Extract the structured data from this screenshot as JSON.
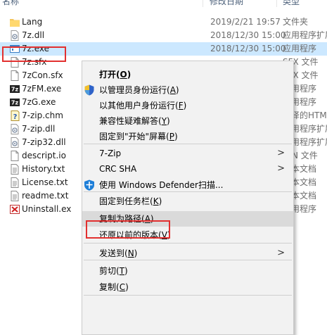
{
  "header": {
    "name": "名称",
    "date": "修改日期",
    "type": "类型"
  },
  "files": [
    {
      "name": "Lang",
      "date": "2019/2/21 19:57",
      "type": "文件夹",
      "icon": "folder-icon"
    },
    {
      "name": "7z.dll",
      "date": "2018/12/30 15:00",
      "type": "应用程序扩展",
      "icon": "dll-icon"
    },
    {
      "name": "7z.exe",
      "date": "2018/12/30 15:00",
      "type": "应用程序",
      "icon": "exe-icon"
    },
    {
      "name": "7z.sfx",
      "date": "",
      "type": "SFX 文件",
      "icon": "blank-file-icon"
    },
    {
      "name": "7zCon.sfx",
      "date": "",
      "type": "SFX 文件",
      "icon": "blank-file-icon"
    },
    {
      "name": "7zFM.exe",
      "date": "",
      "type": "应用程序",
      "icon": "7zip-icon"
    },
    {
      "name": "7zG.exe",
      "date": "",
      "type": "应用程序",
      "icon": "7zip-icon"
    },
    {
      "name": "7-zip.chm",
      "date": "",
      "type": "编译的HTML帮助文件",
      "icon": "help-file-icon"
    },
    {
      "name": "7-zip.dll",
      "date": "",
      "type": "应用程序扩展",
      "icon": "dll-icon"
    },
    {
      "name": "7-zip32.dll",
      "date": "",
      "type": "应用程序扩展",
      "icon": "dll-icon"
    },
    {
      "name": "descript.io",
      "date": "",
      "type": "ION 文件",
      "icon": "blank-file-icon"
    },
    {
      "name": "History.txt",
      "date": "",
      "type": "文本文档",
      "icon": "text-file-icon"
    },
    {
      "name": "License.txt",
      "date": "",
      "type": "文本文档",
      "icon": "text-file-icon"
    },
    {
      "name": "readme.txt",
      "date": "",
      "type": "文本文档",
      "icon": "text-file-icon"
    },
    {
      "name": "Uninstall.ex",
      "date": "",
      "type": "应用程序",
      "icon": "uninstall-icon"
    }
  ],
  "menu": {
    "items": [
      {
        "pre": "打开(",
        "key": "O",
        "post": ")",
        "bold": true
      },
      {
        "pre": "以管理员身份运行(",
        "key": "A",
        "post": ")",
        "icon": "uac-shield-icon"
      },
      {
        "pre": "以其他用户身份运行(",
        "key": "F",
        "post": ")"
      },
      {
        "pre": "兼容性疑难解答(",
        "key": "Y",
        "post": ")"
      },
      {
        "pre": "固定到\"开始\"屏幕(",
        "key": "P",
        "post": ")"
      },
      {
        "pre": "7-Zip",
        "key": "",
        "post": "",
        "arrow": ">"
      },
      {
        "pre": "CRC SHA",
        "key": "",
        "post": "",
        "arrow": ">"
      },
      {
        "pre": "使用 Windows Defender扫描...",
        "key": "",
        "post": "",
        "icon": "defender-icon"
      },
      {
        "pre": "固定到任务栏(",
        "key": "K",
        "post": ")"
      },
      {
        "pre": "复制为路径(",
        "key": "A",
        "post": ")",
        "highlight": true
      },
      {
        "pre": "还原以前的版本(",
        "key": "V",
        "post": ")"
      },
      {
        "pre": "发送到(",
        "key": "N",
        "post": ")",
        "arrow": ">"
      },
      {
        "pre": "剪切(",
        "key": "T",
        "post": ")"
      },
      {
        "pre": "复制(",
        "key": "C",
        "post": ")"
      }
    ]
  },
  "colors": {
    "selection": "#cce8ff",
    "highlight_box": "#e2302f",
    "menu_bg": "#f2f2f2",
    "menu_hover": "#dadada"
  }
}
